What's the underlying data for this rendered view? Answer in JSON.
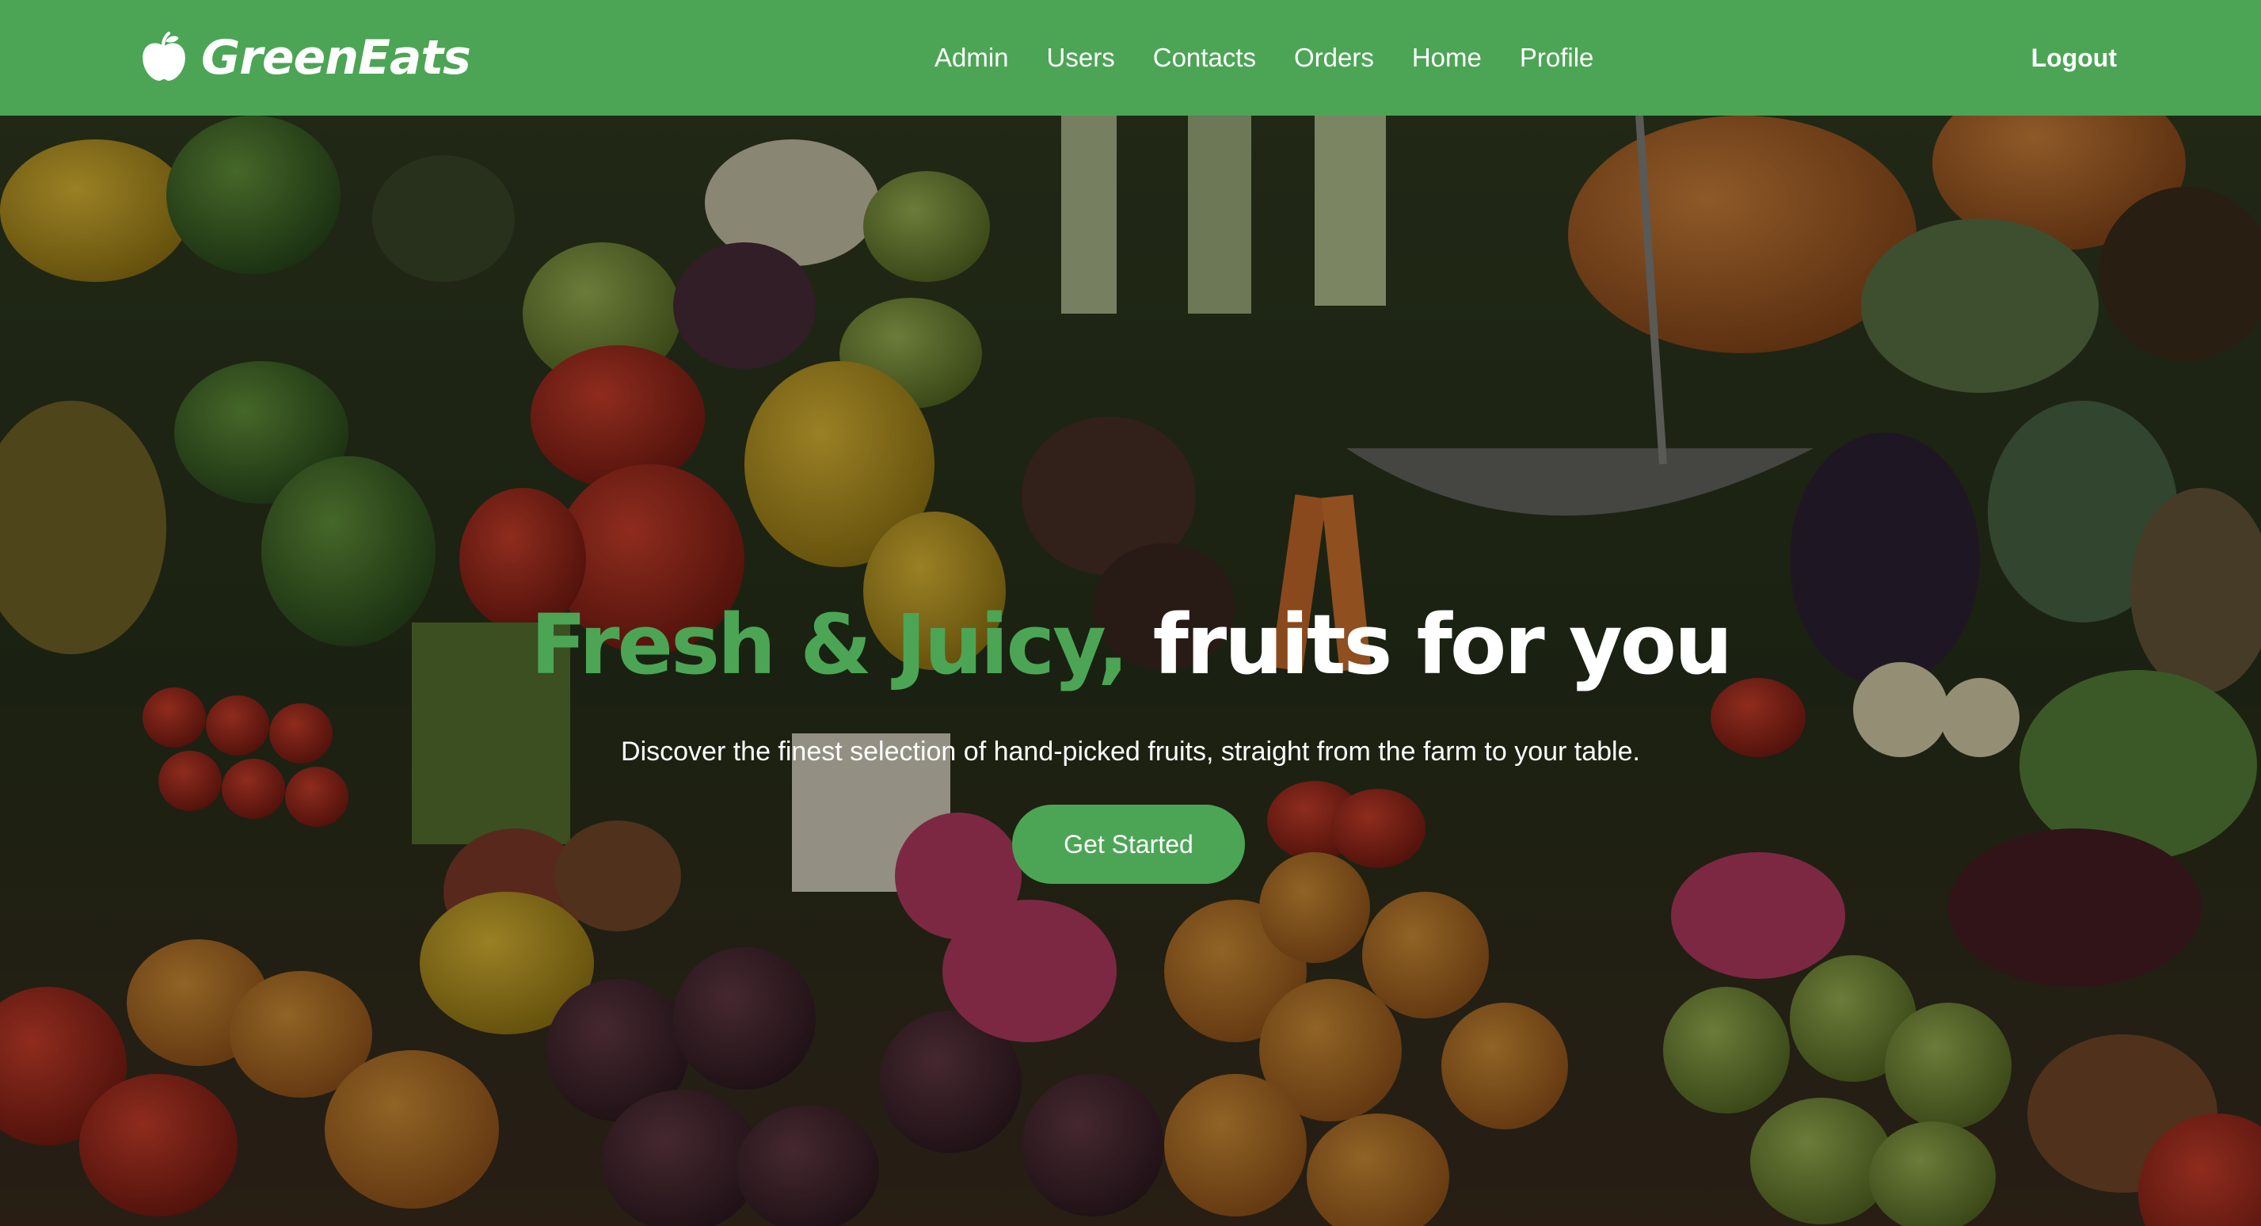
{
  "navbar": {
    "brand": {
      "name": "GreenEats",
      "icon": "apple-icon"
    },
    "links": [
      "Admin",
      "Users",
      "Contacts",
      "Orders",
      "Home",
      "Profile"
    ],
    "logout_label": "Logout",
    "background_color": "#4ca555"
  },
  "hero": {
    "headline_highlight": "Fresh & Juicy,",
    "headline_rest": "fruits for you",
    "subtitle": "Discover the finest selection of hand-picked fruits, straight from the farm to your table.",
    "cta_label": "Get Started",
    "accent_color": "#4ca555",
    "background_image": "produce-market-photo"
  }
}
